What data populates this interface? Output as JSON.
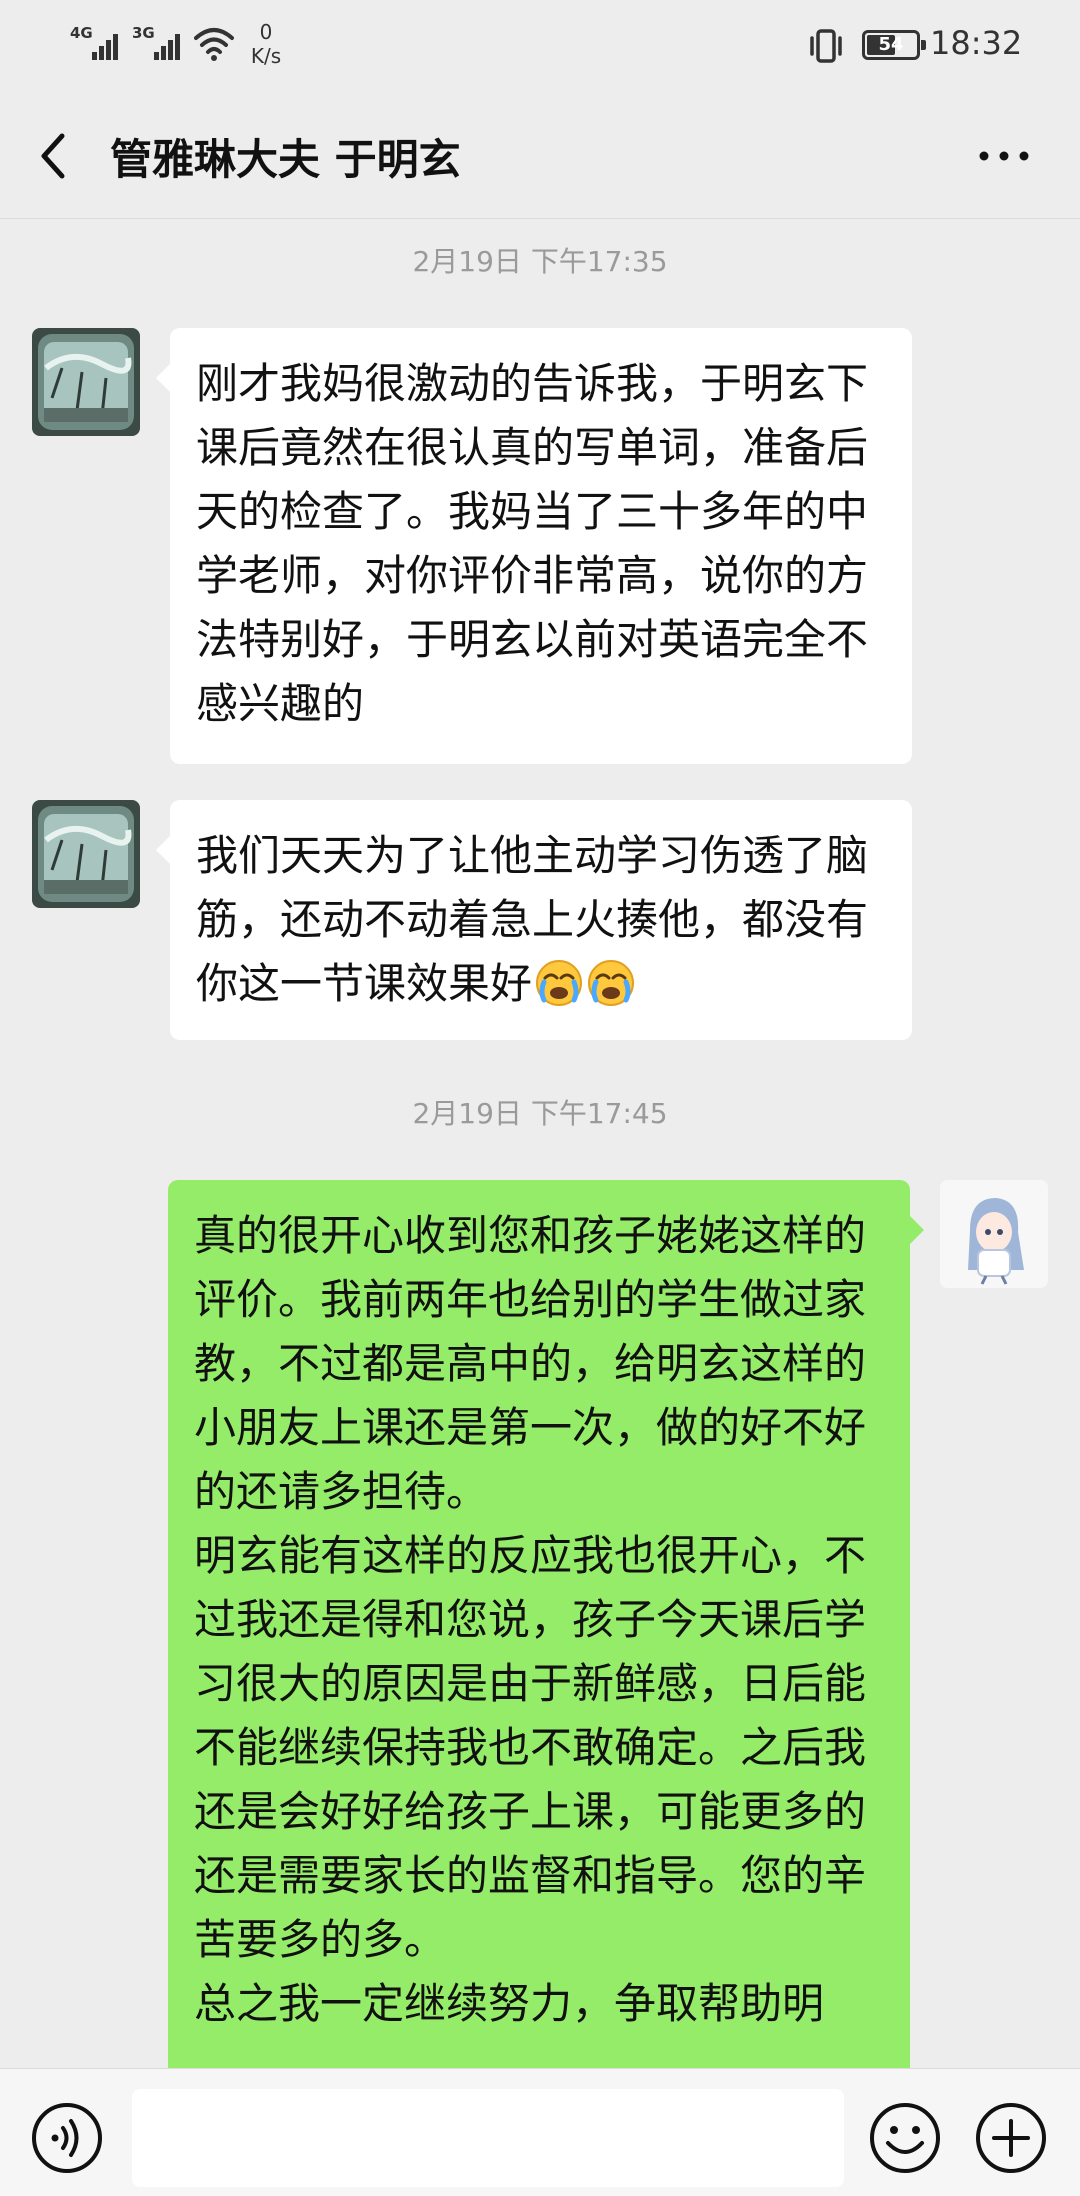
{
  "status_bar": {
    "sim1": "4G",
    "sim2": "3G",
    "net_speed_value": "0",
    "net_speed_unit": "K/s",
    "battery": "54",
    "time": "18:32"
  },
  "header": {
    "title": "管雅琳大夫 于明玄",
    "back_icon": "chevron-left-icon",
    "more_icon": "ellipsis-icon"
  },
  "chat": {
    "timestamps": [
      "2月19日 下午17:35",
      "2月19日 下午17:45"
    ],
    "messages": [
      {
        "side": "left",
        "text": "刚才我妈很激动的告诉我，于明玄下课后竟然在很认真的写单词，准备后天的检查了。我妈当了三十多年的中学老师，对你评价非常高，说你的方法特别好，于明玄以前对英语完全不感兴趣的"
      },
      {
        "side": "left",
        "text": "我们天天为了让他主动学习伤透了脑筋，还动不动着急上火揍他，都没有你这一节课效果好",
        "emojis": [
          "crying-face-emoji",
          "crying-face-emoji"
        ]
      },
      {
        "side": "right",
        "text": "真的很开心收到您和孩子姥姥这样的评价。我前两年也给别的学生做过家教，不过都是高中的，给明玄这样的小朋友上课还是第一次，做的好不好的还请多担待。\n明玄能有这样的反应我也很开心，不过我还是得和您说，孩子今天课后学习很大的原因是由于新鲜感，日后能不能继续保持我也不敢确定。之后我还是会好好给孩子上课，可能更多的还是需要家长的监督和指导。您的辛苦要多的多。\n总之我一定继续努力，争取帮助明"
      }
    ]
  },
  "input_bar": {
    "voice_icon": "voice-icon",
    "emoji_icon": "smiley-icon",
    "plus_icon": "plus-icon",
    "input_value": ""
  },
  "colors": {
    "background": "#ededed",
    "bubble_in": "#ffffff",
    "bubble_out": "#95ec69",
    "timestamp": "#9a9a9a"
  }
}
